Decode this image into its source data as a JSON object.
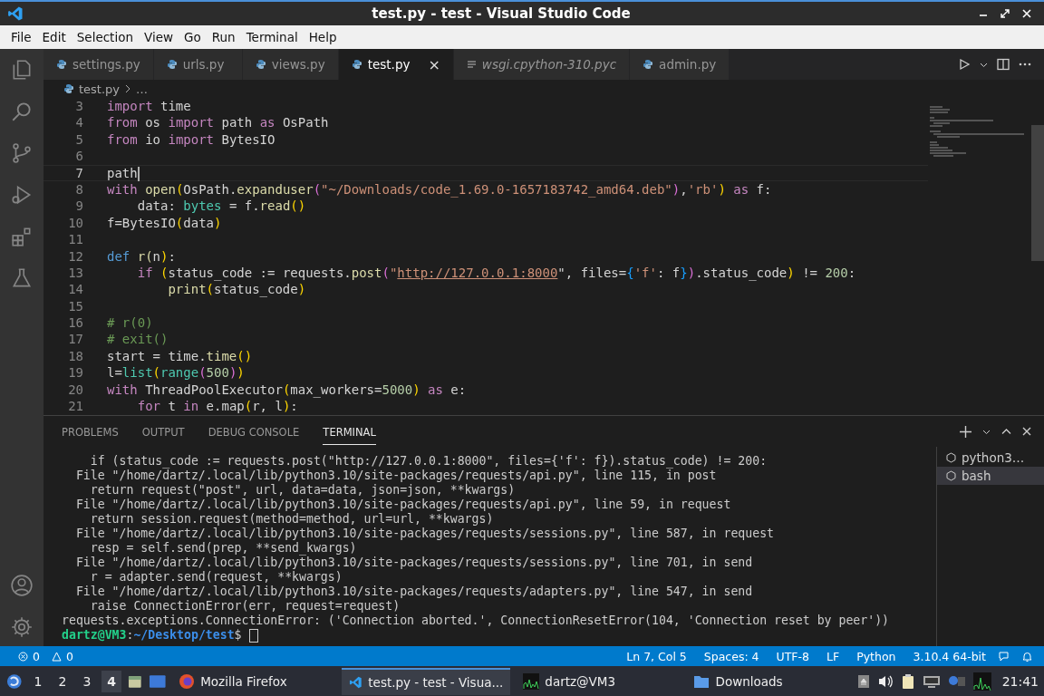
{
  "window": {
    "title": "test.py - test - Visual Studio Code"
  },
  "menu": [
    "File",
    "Edit",
    "Selection",
    "View",
    "Go",
    "Run",
    "Terminal",
    "Help"
  ],
  "tabs": [
    {
      "label": "settings.py",
      "kind": "python",
      "selected": false,
      "preview": false
    },
    {
      "label": "urls.py",
      "kind": "python",
      "selected": false,
      "preview": false
    },
    {
      "label": "views.py",
      "kind": "python",
      "selected": false,
      "preview": false
    },
    {
      "label": "test.py",
      "kind": "python",
      "selected": true,
      "preview": false,
      "close": "×"
    },
    {
      "label": "wsgi.cpython-310.pyc",
      "kind": "text",
      "selected": false,
      "preview": true
    },
    {
      "label": "admin.py",
      "kind": "python",
      "selected": false,
      "preview": false
    }
  ],
  "breadcrumbs": {
    "file": "test.py",
    "rest": "…"
  },
  "editor": {
    "lines": [
      {
        "no": "3",
        "current": false,
        "tokens": [
          {
            "text": "import ",
            "color": "#c586c0"
          },
          {
            "text": "time"
          }
        ]
      },
      {
        "no": "4",
        "current": false,
        "tokens": [
          {
            "text": "from ",
            "color": "#c586c0"
          },
          {
            "text": "os "
          },
          {
            "text": "import ",
            "color": "#c586c0"
          },
          {
            "text": "path "
          },
          {
            "text": "as ",
            "color": "#c586c0"
          },
          {
            "text": "OsPath"
          }
        ]
      },
      {
        "no": "5",
        "current": false,
        "tokens": [
          {
            "text": "from ",
            "color": "#c586c0"
          },
          {
            "text": "io "
          },
          {
            "text": "import ",
            "color": "#c586c0"
          },
          {
            "text": "BytesIO"
          }
        ]
      },
      {
        "no": "6",
        "current": false
      },
      {
        "no": "7",
        "current": true,
        "tokens": [
          {
            "text": "path"
          }
        ]
      },
      {
        "no": "8",
        "current": false,
        "tokens": [
          {
            "text": "with ",
            "color": "#c586c0"
          },
          {
            "text": "open",
            "color": "#dcdcaa"
          },
          {
            "text": "(",
            "color": "#ffd700"
          },
          {
            "text": "OsPath."
          },
          {
            "text": "expanduser",
            "color": "#dcdcaa"
          },
          {
            "text": "(",
            "color": "#da70d6"
          },
          {
            "text": "\"~/Downloads/code_1.69.0-1657183742_amd64.deb\"",
            "color": "#ce9178"
          },
          {
            "text": ")",
            "color": "#da70d6"
          },
          {
            "text": ","
          },
          {
            "text": "'rb'",
            "color": "#ce9178"
          },
          {
            "text": ") ",
            "color": "#ffd700"
          },
          {
            "text": "as ",
            "color": "#c586c0"
          },
          {
            "text": "f:"
          }
        ]
      },
      {
        "no": "9",
        "current": false,
        "tokens": [
          {
            "text": "    data: "
          },
          {
            "text": "bytes",
            "color": "#4ec9b0"
          },
          {
            "text": " = f."
          },
          {
            "text": "read",
            "color": "#dcdcaa"
          },
          {
            "text": "()",
            "color": "#ffd700"
          }
        ]
      },
      {
        "no": "10",
        "current": false,
        "tokens": [
          {
            "text": "f=BytesIO"
          },
          {
            "text": "(",
            "color": "#ffd700"
          },
          {
            "text": "data"
          },
          {
            "text": ")",
            "color": "#ffd700"
          }
        ]
      },
      {
        "no": "11",
        "current": false
      },
      {
        "no": "12",
        "current": false,
        "tokens": [
          {
            "text": "def ",
            "color": "#569cd6"
          },
          {
            "text": "r(",
            "color": "#dcdcaa"
          },
          {
            "text": "n"
          },
          {
            "text": ")",
            "color": "#ffd700"
          },
          {
            "text": ":"
          }
        ]
      },
      {
        "no": "13",
        "current": false,
        "tokens": [
          {
            "text": "    if ",
            "color": "#c586c0"
          },
          {
            "text": "(",
            "color": "#ffd700"
          },
          {
            "text": "status_code := requests."
          },
          {
            "text": "post",
            "color": "#dcdcaa"
          },
          {
            "text": "(",
            "color": "#da70d6"
          },
          {
            "text": "\"",
            "color": "#ce9178"
          },
          {
            "text": "http://127.0.0.1:8000",
            "color": "#ce9178",
            "underline": true
          },
          {
            "text": "\", files="
          },
          {
            "text": "{",
            "color": "#179fff"
          },
          {
            "text": "'f'",
            "color": "#ce9178"
          },
          {
            "text": ": f"
          },
          {
            "text": "}",
            "color": "#179fff"
          },
          {
            "text": ")",
            "color": "#da70d6"
          },
          {
            "text": ".status_code"
          },
          {
            "text": ")",
            "color": "#ffd700"
          },
          {
            "text": " != "
          },
          {
            "text": "200",
            "color": "#b5cea8"
          },
          {
            "text": ":"
          }
        ]
      },
      {
        "no": "14",
        "current": false,
        "tokens": [
          {
            "text": "        print",
            "color": "#dcdcaa"
          },
          {
            "text": "(",
            "color": "#ffd700"
          },
          {
            "text": "status_code"
          },
          {
            "text": ")",
            "color": "#ffd700"
          }
        ]
      },
      {
        "no": "15",
        "current": false
      },
      {
        "no": "16",
        "current": false,
        "tokens": [
          {
            "text": "# r(0)",
            "color": "#6a9955"
          }
        ]
      },
      {
        "no": "17",
        "current": false,
        "tokens": [
          {
            "text": "# exit()",
            "color": "#6a9955"
          }
        ]
      },
      {
        "no": "18",
        "current": false,
        "tokens": [
          {
            "text": "start = time."
          },
          {
            "text": "time",
            "color": "#dcdcaa"
          },
          {
            "text": "()",
            "color": "#ffd700"
          }
        ]
      },
      {
        "no": "19",
        "current": false,
        "tokens": [
          {
            "text": "l="
          },
          {
            "text": "list",
            "color": "#4ec9b0"
          },
          {
            "text": "(",
            "color": "#ffd700"
          },
          {
            "text": "range",
            "color": "#4ec9b0"
          },
          {
            "text": "(",
            "color": "#da70d6"
          },
          {
            "text": "500",
            "color": "#b5cea8"
          },
          {
            "text": ")",
            "color": "#da70d6"
          },
          {
            "text": ")",
            "color": "#ffd700"
          }
        ]
      },
      {
        "no": "20",
        "current": false,
        "tokens": [
          {
            "text": "with ",
            "color": "#c586c0"
          },
          {
            "text": "ThreadPoolExecutor"
          },
          {
            "text": "(",
            "color": "#ffd700"
          },
          {
            "text": "max_workers="
          },
          {
            "text": "5000",
            "color": "#b5cea8"
          },
          {
            "text": ") ",
            "color": "#ffd700"
          },
          {
            "text": "as ",
            "color": "#c586c0"
          },
          {
            "text": "e:"
          }
        ]
      },
      {
        "no": "21",
        "current": false,
        "tokens": [
          {
            "text": "    for ",
            "color": "#c586c0"
          },
          {
            "text": "t "
          },
          {
            "text": "in ",
            "color": "#c586c0"
          },
          {
            "text": "e.map"
          },
          {
            "text": "(",
            "color": "#ffd700"
          },
          {
            "text": "r, l"
          },
          {
            "text": ")",
            "color": "#ffd700"
          },
          {
            "text": ":"
          }
        ]
      }
    ]
  },
  "panel": {
    "tabs": [
      {
        "label": "PROBLEMS",
        "selected": false
      },
      {
        "label": "OUTPUT",
        "selected": false
      },
      {
        "label": "DEBUG CONSOLE",
        "selected": false
      },
      {
        "label": "TERMINAL",
        "selected": true
      }
    ],
    "terminal_lines": [
      "    if (status_code := requests.post(\"http://127.0.0.1:8000\", files={'f': f}).status_code) != 200:",
      "  File \"/home/dartz/.local/lib/python3.10/site-packages/requests/api.py\", line 115, in post",
      "    return request(\"post\", url, data=data, json=json, **kwargs)",
      "  File \"/home/dartz/.local/lib/python3.10/site-packages/requests/api.py\", line 59, in request",
      "    return session.request(method=method, url=url, **kwargs)",
      "  File \"/home/dartz/.local/lib/python3.10/site-packages/requests/sessions.py\", line 587, in request",
      "    resp = self.send(prep, **send_kwargs)",
      "  File \"/home/dartz/.local/lib/python3.10/site-packages/requests/sessions.py\", line 701, in send",
      "    r = adapter.send(request, **kwargs)",
      "  File \"/home/dartz/.local/lib/python3.10/site-packages/requests/adapters.py\", line 547, in send",
      "    raise ConnectionError(err, request=request)",
      "requests.exceptions.ConnectionError: ('Connection aborted.', ConnectionResetError(104, 'Connection reset by peer'))"
    ],
    "prompt": {
      "user": "dartz@VM3",
      "sep": ":",
      "path": "~/Desktop/test",
      "symbol": "$"
    },
    "terminals": [
      {
        "label": "python3…",
        "selected": false
      },
      {
        "label": "bash",
        "selected": true
      }
    ]
  },
  "status_bar": {
    "errors": "0",
    "warnings": "0",
    "items": [
      "Ln 7, Col 5",
      "Spaces: 4",
      "UTF-8",
      "LF",
      "Python",
      "3.10.4 64-bit"
    ]
  },
  "taskbar": {
    "workspaces": [
      {
        "label": "1",
        "selected": false
      },
      {
        "label": "2",
        "selected": false
      },
      {
        "label": "3",
        "selected": false
      },
      {
        "label": "4",
        "selected": true
      }
    ],
    "apps": [
      {
        "label": "Mozilla Firefox",
        "kind": "firefox",
        "selected": false
      },
      {
        "label": "test.py - test - Visua...",
        "kind": "vscode",
        "selected": true
      },
      {
        "label": "dartz@VM3",
        "kind": "terminal",
        "selected": false
      },
      {
        "label": "Downloads",
        "kind": "folder",
        "selected": false
      }
    ],
    "clock": "21:41"
  }
}
